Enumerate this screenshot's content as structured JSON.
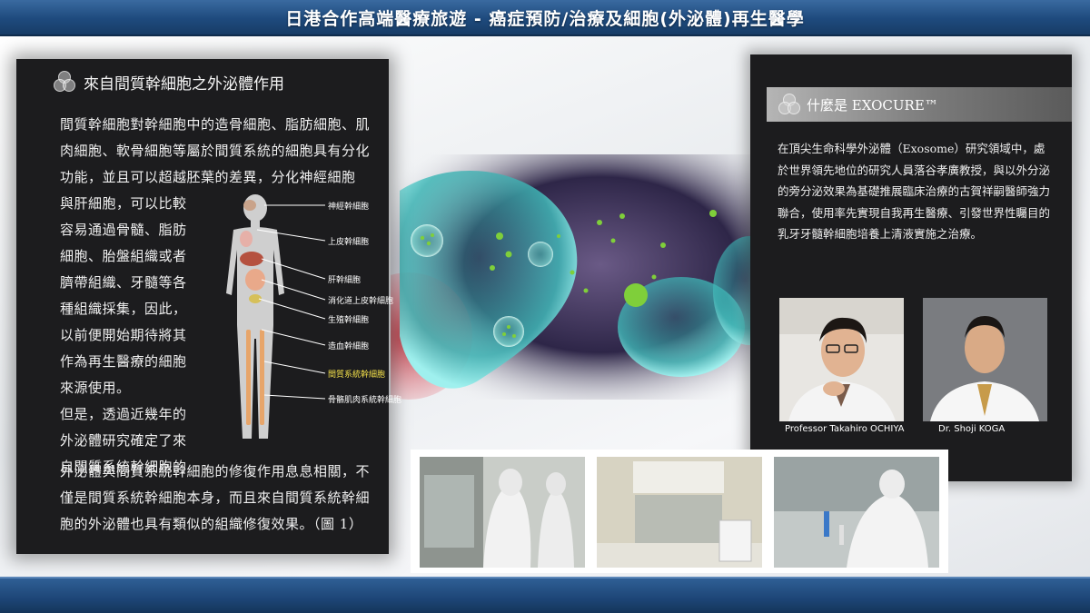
{
  "header": {
    "title": "日港合作高端醫療旅遊 - 癌症預防/治療及細胞(外泌體)再生醫學"
  },
  "left_panel": {
    "heading": "來自間質幹細胞之外泌體作用",
    "paragraph_top": "間質幹細胞對幹細胞中的造骨細胞、脂肪細胞、肌肉細胞、軟骨細胞等屬於間質系統的細胞具有分化功能，並且可以超越胚葉的差異，分化神經細胞",
    "paragraph_side": [
      "與肝細胞，可以比較",
      "容易通過骨髓、脂肪",
      "細胞、胎盤組織或者",
      "臍帶組織、牙髓等各",
      "種組織採集，因此，",
      "以前便開始期待將其",
      "作為再生醫療的細胞",
      "來源使用。",
      "但是，透過近幾年的",
      "外泌體研究確定了來",
      "自間質系統幹細胞的"
    ],
    "paragraph_bottom": "外泌體與間質系統幹細胞的修復作用息息相關，不僅是間質系統幹細胞本身，而且來自間質系統幹細胞的外泌體也具有類似的組織修復效果。（圖 1）",
    "figure_labels": [
      {
        "text": "神經幹細胞",
        "highlight": false
      },
      {
        "text": "上皮幹細胞",
        "highlight": false
      },
      {
        "text": "肝幹細胞",
        "highlight": false
      },
      {
        "text": "消化道上皮幹細胞",
        "highlight": false
      },
      {
        "text": "生殖幹細胞",
        "highlight": false
      },
      {
        "text": "造血幹細胞",
        "highlight": false
      },
      {
        "text": "間質系統幹細胞",
        "highlight": true
      },
      {
        "text": "骨骼肌肉系統幹細胞",
        "highlight": false
      }
    ]
  },
  "right_panel": {
    "heading": "什麼是 EXOCURE™",
    "paragraph": "在頂尖生命科學外泌體（Exosome）研究領域中，處於世界領先地位的研究人員落谷孝廣教授，與以外分泌的旁分泌效果為基礎推展臨床治療的古賀祥嗣醫師強力聯合，使用率先實現自我再生醫療、引發世界性矚目的乳牙牙髓幹細胞培養上清液實施之治療。",
    "photos": [
      {
        "caption": "Professor Takahiro OCHIYA"
      },
      {
        "caption": "Dr.  Shoji KOGA"
      }
    ]
  },
  "colors": {
    "header_blue": "#1e4a7d",
    "panel_dark": "#1c1c1e",
    "label_highlight": "#f3e04a",
    "exosome_green": "#7fcf3a",
    "cell_teal": "#3fb6b6"
  }
}
